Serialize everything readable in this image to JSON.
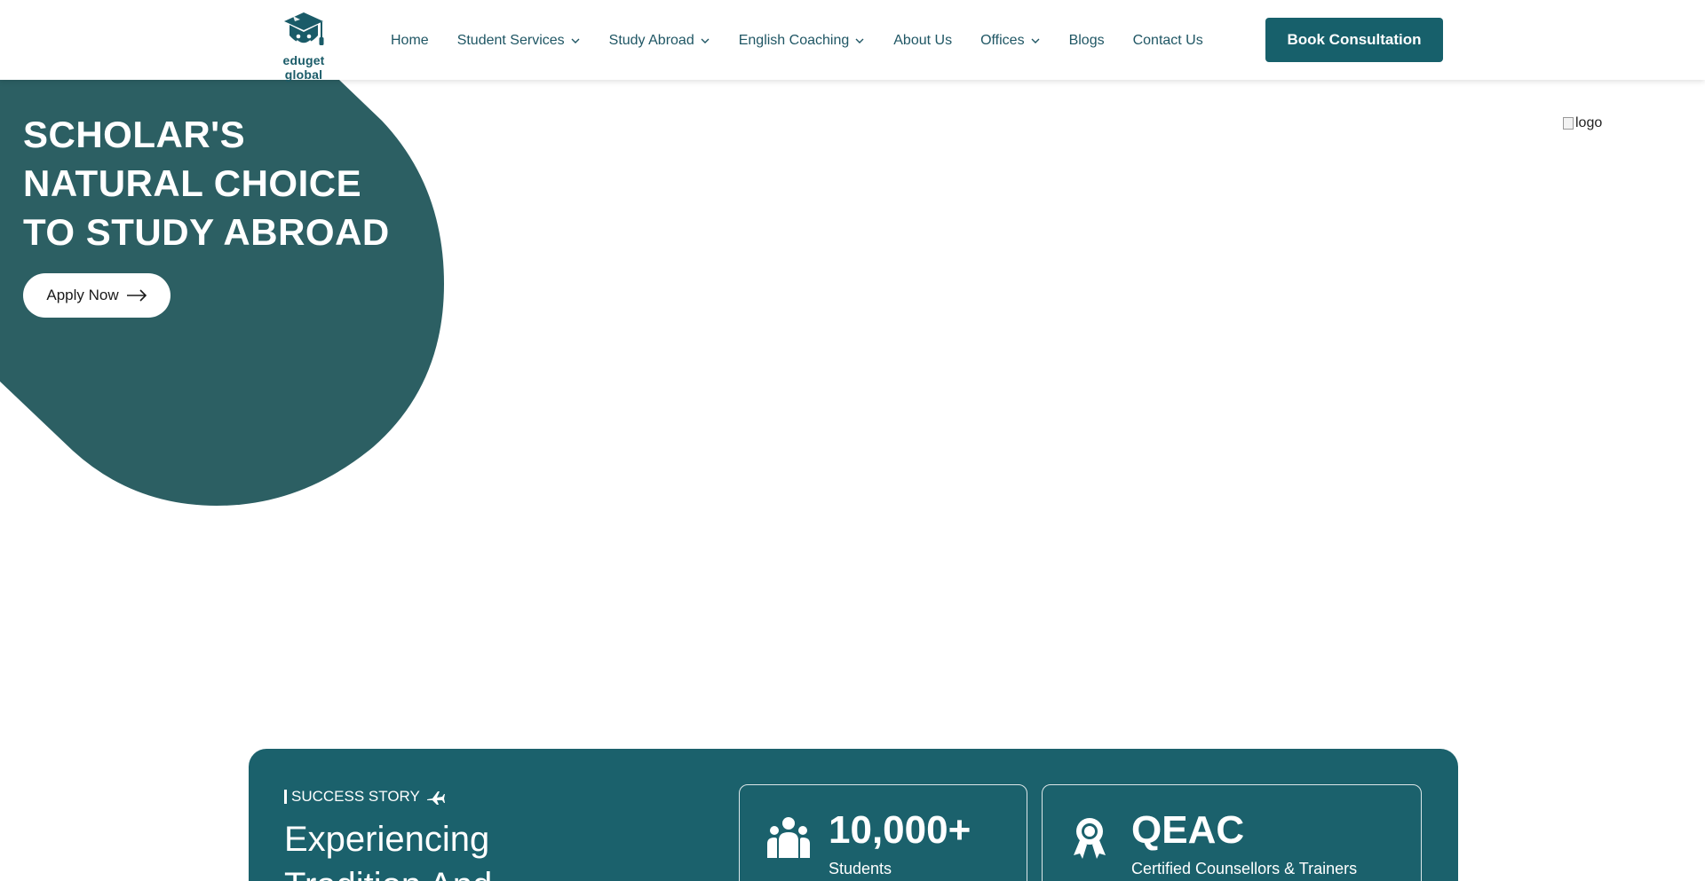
{
  "header": {
    "logo_text": "eduget global",
    "nav": [
      {
        "label": "Home",
        "dropdown": false
      },
      {
        "label": "Student Services",
        "dropdown": true
      },
      {
        "label": "Study Abroad",
        "dropdown": true
      },
      {
        "label": "English Coaching",
        "dropdown": true
      },
      {
        "label": "About Us",
        "dropdown": false
      },
      {
        "label": "Offices",
        "dropdown": true
      },
      {
        "label": "Blogs",
        "dropdown": false
      },
      {
        "label": "Contact Us",
        "dropdown": false
      }
    ],
    "cta_label": "Book Consultation"
  },
  "hero": {
    "title_lines": [
      "SCHOLAR'S",
      "NATURAL CHOICE",
      "TO STUDY ABROAD"
    ],
    "apply_label": "Apply Now",
    "broken_image_alt": "logo"
  },
  "success": {
    "label": "SUCCESS STORY",
    "heading_lines": [
      "Experiencing",
      "Tradition And"
    ],
    "stats": [
      {
        "value": "10,000+",
        "caption": "Students",
        "icon": "students-icon"
      },
      {
        "value": "QEAC",
        "caption": "Certified Counsellors & Trainers",
        "icon": "award-icon"
      }
    ]
  },
  "colors": {
    "primary": "#17606b",
    "hero_shape": "#2c5f63",
    "nav_text": "#1f5664"
  }
}
